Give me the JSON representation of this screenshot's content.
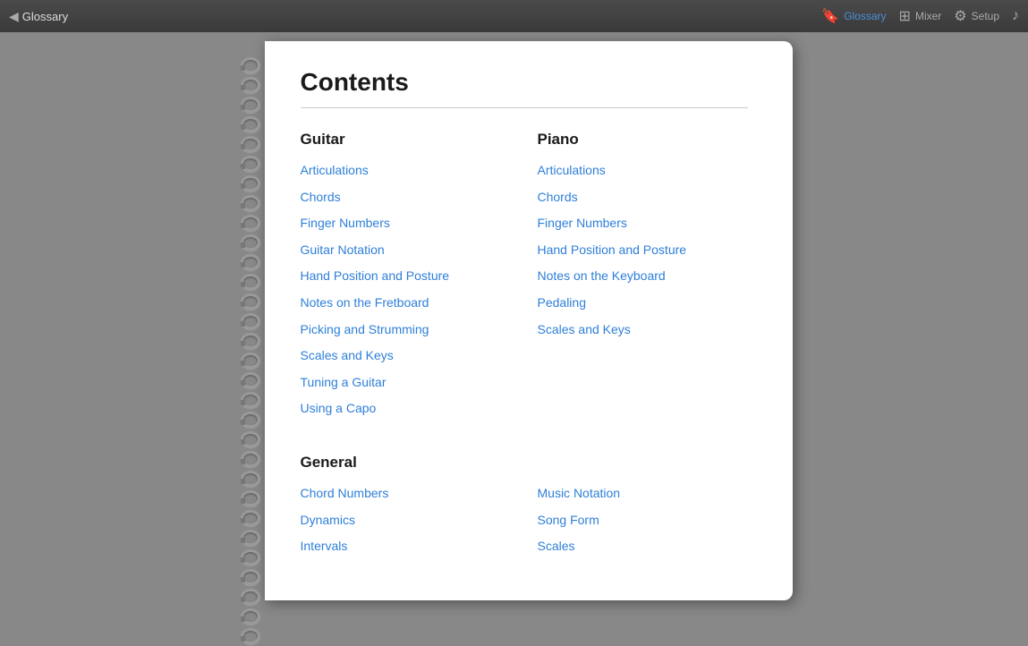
{
  "titlebar": {
    "back_arrow": "◀",
    "back_label": "Glossary",
    "nav_items": [
      {
        "id": "glossary",
        "label": "Glossary",
        "icon": "🔖",
        "active": true
      },
      {
        "id": "mixer",
        "label": "Mixer",
        "icon": "⊞",
        "active": false
      },
      {
        "id": "setup",
        "label": "Setup",
        "icon": "⚙",
        "active": false
      },
      {
        "id": "music",
        "label": "",
        "icon": "♪",
        "active": false
      }
    ]
  },
  "page": {
    "title": "Contents",
    "guitar": {
      "heading": "Guitar",
      "links": [
        "Articulations",
        "Chords",
        "Finger Numbers",
        "Guitar Notation",
        "Hand Position and Posture",
        "Notes on the Fretboard",
        "Picking and Strumming",
        "Scales and Keys",
        "Tuning a Guitar",
        "Using a Capo"
      ]
    },
    "piano": {
      "heading": "Piano",
      "links": [
        "Articulations",
        "Chords",
        "Finger Numbers",
        "Hand Position and Posture",
        "Notes on the Keyboard",
        "Pedaling",
        "Scales and Keys"
      ]
    },
    "general": {
      "heading": "General",
      "left_links": [
        "Chord Numbers",
        "Dynamics",
        "Intervals"
      ],
      "right_links": [
        "Music Notation",
        "Song Form",
        "Scales"
      ]
    }
  }
}
